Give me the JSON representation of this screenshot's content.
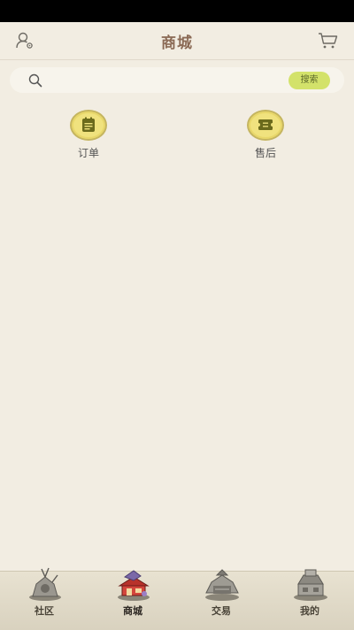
{
  "header": {
    "title": "商城"
  },
  "search": {
    "placeholder": "",
    "button_label": "搜索"
  },
  "entries": [
    {
      "label": "订单",
      "icon": "order-clipboard-icon"
    },
    {
      "label": "售后",
      "icon": "after-sales-ticket-icon"
    }
  ],
  "tabbar": {
    "active": "商城",
    "tabs": [
      {
        "label": "社区",
        "icon": "community-building-icon"
      },
      {
        "label": "商城",
        "icon": "shop-building-icon"
      },
      {
        "label": "交易",
        "icon": "trade-building-icon"
      },
      {
        "label": "我的",
        "icon": "profile-building-icon"
      }
    ]
  },
  "colors": {
    "background": "#f2ede2",
    "title": "#8b6a55",
    "search_button": "#d3e26a",
    "badge_fill": "#f0e27e",
    "badge_icon": "#6b6a1c"
  }
}
